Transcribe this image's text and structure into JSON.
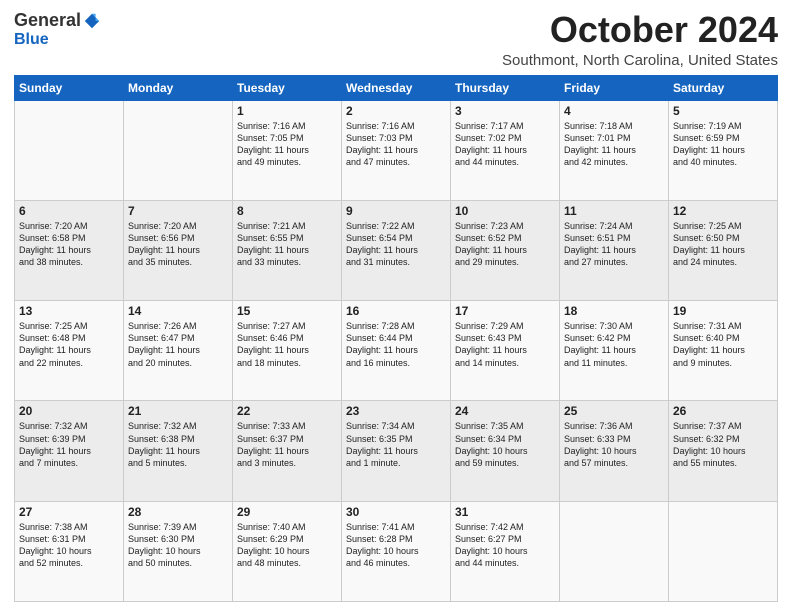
{
  "logo": {
    "general": "General",
    "blue": "Blue"
  },
  "header": {
    "month": "October 2024",
    "location": "Southmont, North Carolina, United States"
  },
  "days_of_week": [
    "Sunday",
    "Monday",
    "Tuesday",
    "Wednesday",
    "Thursday",
    "Friday",
    "Saturday"
  ],
  "weeks": [
    [
      {
        "day": "",
        "info": ""
      },
      {
        "day": "",
        "info": ""
      },
      {
        "day": "1",
        "info": "Sunrise: 7:16 AM\nSunset: 7:05 PM\nDaylight: 11 hours\nand 49 minutes."
      },
      {
        "day": "2",
        "info": "Sunrise: 7:16 AM\nSunset: 7:03 PM\nDaylight: 11 hours\nand 47 minutes."
      },
      {
        "day": "3",
        "info": "Sunrise: 7:17 AM\nSunset: 7:02 PM\nDaylight: 11 hours\nand 44 minutes."
      },
      {
        "day": "4",
        "info": "Sunrise: 7:18 AM\nSunset: 7:01 PM\nDaylight: 11 hours\nand 42 minutes."
      },
      {
        "day": "5",
        "info": "Sunrise: 7:19 AM\nSunset: 6:59 PM\nDaylight: 11 hours\nand 40 minutes."
      }
    ],
    [
      {
        "day": "6",
        "info": "Sunrise: 7:20 AM\nSunset: 6:58 PM\nDaylight: 11 hours\nand 38 minutes."
      },
      {
        "day": "7",
        "info": "Sunrise: 7:20 AM\nSunset: 6:56 PM\nDaylight: 11 hours\nand 35 minutes."
      },
      {
        "day": "8",
        "info": "Sunrise: 7:21 AM\nSunset: 6:55 PM\nDaylight: 11 hours\nand 33 minutes."
      },
      {
        "day": "9",
        "info": "Sunrise: 7:22 AM\nSunset: 6:54 PM\nDaylight: 11 hours\nand 31 minutes."
      },
      {
        "day": "10",
        "info": "Sunrise: 7:23 AM\nSunset: 6:52 PM\nDaylight: 11 hours\nand 29 minutes."
      },
      {
        "day": "11",
        "info": "Sunrise: 7:24 AM\nSunset: 6:51 PM\nDaylight: 11 hours\nand 27 minutes."
      },
      {
        "day": "12",
        "info": "Sunrise: 7:25 AM\nSunset: 6:50 PM\nDaylight: 11 hours\nand 24 minutes."
      }
    ],
    [
      {
        "day": "13",
        "info": "Sunrise: 7:25 AM\nSunset: 6:48 PM\nDaylight: 11 hours\nand 22 minutes."
      },
      {
        "day": "14",
        "info": "Sunrise: 7:26 AM\nSunset: 6:47 PM\nDaylight: 11 hours\nand 20 minutes."
      },
      {
        "day": "15",
        "info": "Sunrise: 7:27 AM\nSunset: 6:46 PM\nDaylight: 11 hours\nand 18 minutes."
      },
      {
        "day": "16",
        "info": "Sunrise: 7:28 AM\nSunset: 6:44 PM\nDaylight: 11 hours\nand 16 minutes."
      },
      {
        "day": "17",
        "info": "Sunrise: 7:29 AM\nSunset: 6:43 PM\nDaylight: 11 hours\nand 14 minutes."
      },
      {
        "day": "18",
        "info": "Sunrise: 7:30 AM\nSunset: 6:42 PM\nDaylight: 11 hours\nand 11 minutes."
      },
      {
        "day": "19",
        "info": "Sunrise: 7:31 AM\nSunset: 6:40 PM\nDaylight: 11 hours\nand 9 minutes."
      }
    ],
    [
      {
        "day": "20",
        "info": "Sunrise: 7:32 AM\nSunset: 6:39 PM\nDaylight: 11 hours\nand 7 minutes."
      },
      {
        "day": "21",
        "info": "Sunrise: 7:32 AM\nSunset: 6:38 PM\nDaylight: 11 hours\nand 5 minutes."
      },
      {
        "day": "22",
        "info": "Sunrise: 7:33 AM\nSunset: 6:37 PM\nDaylight: 11 hours\nand 3 minutes."
      },
      {
        "day": "23",
        "info": "Sunrise: 7:34 AM\nSunset: 6:35 PM\nDaylight: 11 hours\nand 1 minute."
      },
      {
        "day": "24",
        "info": "Sunrise: 7:35 AM\nSunset: 6:34 PM\nDaylight: 10 hours\nand 59 minutes."
      },
      {
        "day": "25",
        "info": "Sunrise: 7:36 AM\nSunset: 6:33 PM\nDaylight: 10 hours\nand 57 minutes."
      },
      {
        "day": "26",
        "info": "Sunrise: 7:37 AM\nSunset: 6:32 PM\nDaylight: 10 hours\nand 55 minutes."
      }
    ],
    [
      {
        "day": "27",
        "info": "Sunrise: 7:38 AM\nSunset: 6:31 PM\nDaylight: 10 hours\nand 52 minutes."
      },
      {
        "day": "28",
        "info": "Sunrise: 7:39 AM\nSunset: 6:30 PM\nDaylight: 10 hours\nand 50 minutes."
      },
      {
        "day": "29",
        "info": "Sunrise: 7:40 AM\nSunset: 6:29 PM\nDaylight: 10 hours\nand 48 minutes."
      },
      {
        "day": "30",
        "info": "Sunrise: 7:41 AM\nSunset: 6:28 PM\nDaylight: 10 hours\nand 46 minutes."
      },
      {
        "day": "31",
        "info": "Sunrise: 7:42 AM\nSunset: 6:27 PM\nDaylight: 10 hours\nand 44 minutes."
      },
      {
        "day": "",
        "info": ""
      },
      {
        "day": "",
        "info": ""
      }
    ]
  ]
}
